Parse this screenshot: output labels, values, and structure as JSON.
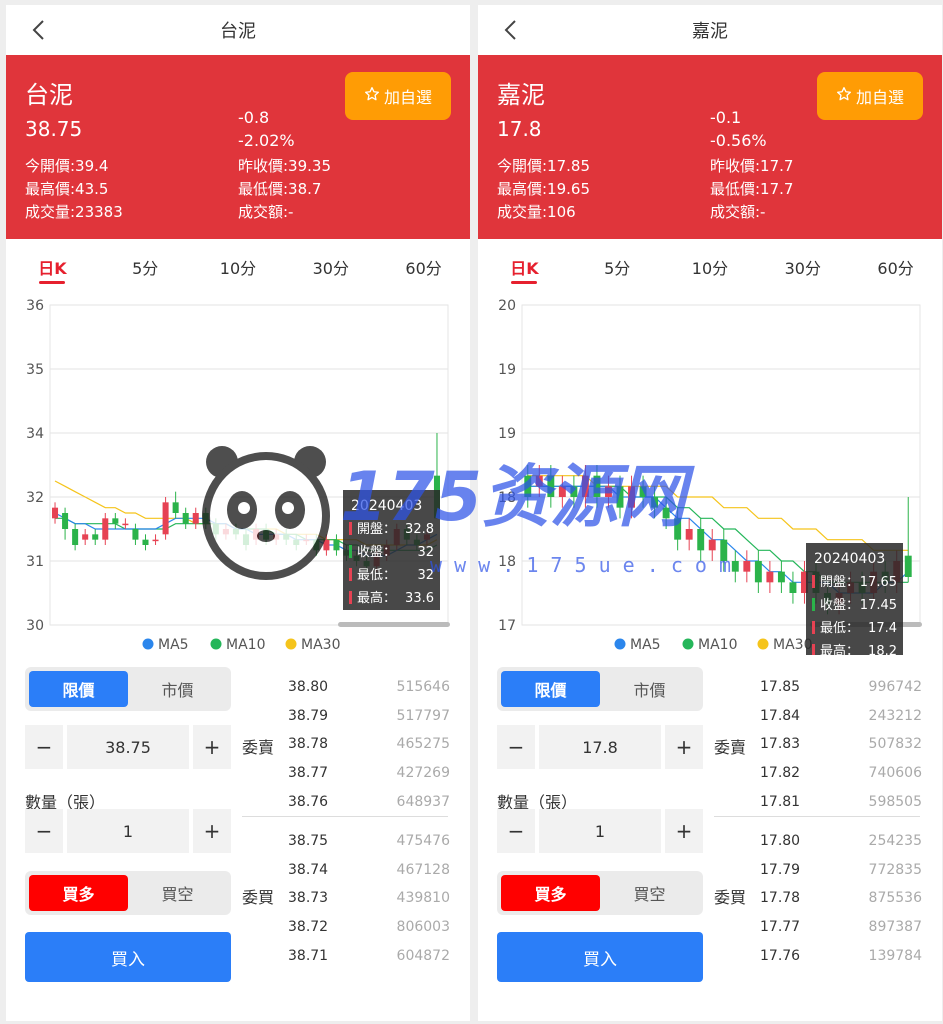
{
  "panels": [
    {
      "nav_title": "台泥",
      "header": {
        "name": "台泥",
        "price": "38.75",
        "change": "-0.8",
        "change_pct": "-2.02%",
        "open": "今開價:39.4",
        "prev_close": "昨收價:39.35",
        "high": "最高價:43.5",
        "low": "最低價:38.7",
        "volume": "成交量:23383",
        "amount": "成交額:-"
      },
      "fav_label": "加自選",
      "tabs": [
        "日K",
        "5分",
        "10分",
        "30分",
        "60分"
      ],
      "chart_data": {
        "type": "candlestick",
        "y_ticks": [
          "36",
          "35",
          "34",
          "32",
          "31",
          "30"
        ],
        "y_range": [
          30,
          36
        ],
        "legend": [
          "MA5",
          "MA10",
          "MA30"
        ],
        "tooltip": {
          "date": "20240403",
          "open_label": "開盤：",
          "open": "32.8",
          "close_label": "收盤：",
          "close": "32",
          "low_label": "最低：",
          "low": "32",
          "high_label": "最高：",
          "high": "33.6"
        },
        "candles": [
          {
            "o": 32.0,
            "c": 32.2,
            "h": 32.3,
            "l": 31.9
          },
          {
            "o": 32.1,
            "c": 31.8,
            "h": 32.2,
            "l": 31.6
          },
          {
            "o": 31.8,
            "c": 31.5,
            "h": 31.9,
            "l": 31.4
          },
          {
            "o": 31.6,
            "c": 31.7,
            "h": 31.8,
            "l": 31.5
          },
          {
            "o": 31.7,
            "c": 31.6,
            "h": 31.8,
            "l": 31.5
          },
          {
            "o": 31.6,
            "c": 32.0,
            "h": 32.1,
            "l": 31.5
          },
          {
            "o": 32.0,
            "c": 31.9,
            "h": 32.1,
            "l": 31.8
          },
          {
            "o": 31.9,
            "c": 31.9,
            "h": 32.0,
            "l": 31.8
          },
          {
            "o": 31.8,
            "c": 31.6,
            "h": 31.9,
            "l": 31.5
          },
          {
            "o": 31.6,
            "c": 31.5,
            "h": 31.7,
            "l": 31.4
          },
          {
            "o": 31.6,
            "c": 31.6,
            "h": 31.7,
            "l": 31.5
          },
          {
            "o": 31.7,
            "c": 32.3,
            "h": 32.4,
            "l": 31.6
          },
          {
            "o": 32.3,
            "c": 32.1,
            "h": 32.5,
            "l": 32.0
          },
          {
            "o": 32.1,
            "c": 31.9,
            "h": 32.2,
            "l": 31.8
          },
          {
            "o": 31.9,
            "c": 32.1,
            "h": 32.2,
            "l": 31.8
          },
          {
            "o": 32.1,
            "c": 31.9,
            "h": 32.2,
            "l": 31.8
          },
          {
            "o": 31.9,
            "c": 31.7,
            "h": 32.0,
            "l": 31.6
          },
          {
            "o": 31.7,
            "c": 31.8,
            "h": 31.9,
            "l": 31.6
          },
          {
            "o": 31.8,
            "c": 31.7,
            "h": 31.9,
            "l": 31.6
          },
          {
            "o": 31.7,
            "c": 31.5,
            "h": 31.8,
            "l": 31.4
          },
          {
            "o": 31.6,
            "c": 31.8,
            "h": 31.9,
            "l": 31.5
          },
          {
            "o": 31.8,
            "c": 31.6,
            "h": 31.9,
            "l": 31.5
          },
          {
            "o": 31.6,
            "c": 31.7,
            "h": 31.8,
            "l": 31.5
          },
          {
            "o": 31.7,
            "c": 31.6,
            "h": 31.8,
            "l": 31.5
          },
          {
            "o": 31.6,
            "c": 31.5,
            "h": 31.7,
            "l": 31.4
          },
          {
            "o": 31.6,
            "c": 31.6,
            "h": 31.7,
            "l": 31.5
          },
          {
            "o": 31.6,
            "c": 31.4,
            "h": 31.7,
            "l": 31.3
          },
          {
            "o": 31.4,
            "c": 31.6,
            "h": 31.7,
            "l": 31.3
          },
          {
            "o": 31.6,
            "c": 31.4,
            "h": 31.7,
            "l": 31.3
          },
          {
            "o": 31.4,
            "c": 31.3,
            "h": 31.5,
            "l": 31.2
          },
          {
            "o": 31.3,
            "c": 31.2,
            "h": 31.4,
            "l": 31.1
          },
          {
            "o": 31.2,
            "c": 31.1,
            "h": 31.3,
            "l": 31.0
          },
          {
            "o": 31.1,
            "c": 31.3,
            "h": 31.4,
            "l": 31.0
          },
          {
            "o": 31.3,
            "c": 31.5,
            "h": 31.6,
            "l": 31.2
          },
          {
            "o": 31.5,
            "c": 31.8,
            "h": 31.9,
            "l": 31.4
          },
          {
            "o": 31.8,
            "c": 31.6,
            "h": 31.9,
            "l": 31.5
          },
          {
            "o": 31.6,
            "c": 31.5,
            "h": 31.7,
            "l": 31.4
          },
          {
            "o": 31.6,
            "c": 31.7,
            "h": 31.8,
            "l": 31.5
          },
          {
            "o": 32.8,
            "c": 32.0,
            "h": 33.6,
            "l": 32.0
          }
        ],
        "ma5": [
          32.1,
          32.0,
          31.9,
          31.9,
          31.8,
          31.8,
          31.8,
          31.8,
          31.8,
          31.8,
          31.8,
          31.9,
          32.0,
          32.0,
          32.0,
          32.0,
          31.9,
          31.9,
          31.8,
          31.8,
          31.7,
          31.7,
          31.7,
          31.7,
          31.6,
          31.6,
          31.6,
          31.5,
          31.5,
          31.4,
          31.4,
          31.3,
          31.3,
          31.3,
          31.4,
          31.5,
          31.5,
          31.6,
          31.7
        ],
        "ma10": [
          32.0,
          32.0,
          31.9,
          31.9,
          31.9,
          31.9,
          31.9,
          31.8,
          31.8,
          31.8,
          31.8,
          31.8,
          31.9,
          31.9,
          31.9,
          31.9,
          31.9,
          31.9,
          31.8,
          31.8,
          31.8,
          31.8,
          31.7,
          31.7,
          31.7,
          31.6,
          31.6,
          31.6,
          31.6,
          31.5,
          31.5,
          31.4,
          31.4,
          31.4,
          31.4,
          31.4,
          31.4,
          31.4,
          31.5
        ],
        "ma30": [
          32.7,
          32.6,
          32.5,
          32.4,
          32.3,
          32.2,
          32.2,
          32.1,
          32.1,
          32.0,
          32.0,
          32.0,
          32.0,
          32.0,
          31.9,
          31.9,
          31.9,
          31.9,
          31.8,
          31.8,
          31.8,
          31.8,
          31.8,
          31.7,
          31.7,
          31.7,
          31.7,
          31.6,
          31.6,
          31.6,
          31.6,
          31.5,
          31.5,
          31.5,
          31.5,
          31.5,
          31.5,
          31.5,
          31.6
        ]
      },
      "trade": {
        "order_type": [
          "限價",
          "市價"
        ],
        "price": "38.75",
        "qty_label": "數量（張）",
        "qty": "1",
        "side": [
          "買多",
          "買空"
        ],
        "submit": "買入",
        "minus": "−",
        "plus": "+"
      },
      "orderbook": {
        "ask_label": "委賣",
        "bid_label": "委買",
        "asks": [
          [
            "38.80",
            "515646"
          ],
          [
            "38.79",
            "517797"
          ],
          [
            "38.78",
            "465275"
          ],
          [
            "38.77",
            "427269"
          ],
          [
            "38.76",
            "648937"
          ]
        ],
        "bids": [
          [
            "38.75",
            "475476"
          ],
          [
            "38.74",
            "467128"
          ],
          [
            "38.73",
            "439810"
          ],
          [
            "38.72",
            "806003"
          ],
          [
            "38.71",
            "604872"
          ]
        ]
      }
    },
    {
      "nav_title": "嘉泥",
      "header": {
        "name": "嘉泥",
        "price": "17.8",
        "change": "-0.1",
        "change_pct": "-0.56%",
        "open": "今開價:17.85",
        "prev_close": "昨收價:17.7",
        "high": "最高價:19.65",
        "low": "最低價:17.7",
        "volume": "成交量:106",
        "amount": "成交額:-"
      },
      "fav_label": "加自選",
      "tabs": [
        "日K",
        "5分",
        "10分",
        "30分",
        "60分"
      ],
      "chart_data": {
        "type": "candlestick",
        "y_ticks": [
          "20",
          "19",
          "19",
          "18",
          "18",
          "17"
        ],
        "y_range": [
          17,
          20
        ],
        "legend": [
          "MA5",
          "MA10",
          "MA30"
        ],
        "tooltip": {
          "date": "20240403",
          "open_label": "開盤：",
          "open": "17.65",
          "close_label": "收盤：",
          "close": "17.45",
          "low_label": "最低：",
          "low": "17.4",
          "high_label": "最高：",
          "high": "18.2"
        },
        "candles": [
          {
            "o": 18.4,
            "c": 18.2,
            "h": 18.5,
            "l": 18.1
          },
          {
            "o": 18.3,
            "c": 18.4,
            "h": 18.5,
            "l": 18.2
          },
          {
            "o": 18.4,
            "c": 18.2,
            "h": 18.5,
            "l": 18.1
          },
          {
            "o": 18.2,
            "c": 18.3,
            "h": 18.4,
            "l": 18.1
          },
          {
            "o": 18.3,
            "c": 18.2,
            "h": 18.4,
            "l": 18.1
          },
          {
            "o": 18.2,
            "c": 18.4,
            "h": 18.5,
            "l": 18.1
          },
          {
            "o": 18.4,
            "c": 18.2,
            "h": 18.5,
            "l": 18.1
          },
          {
            "o": 18.2,
            "c": 18.3,
            "h": 18.4,
            "l": 18.1
          },
          {
            "o": 18.3,
            "c": 18.1,
            "h": 18.4,
            "l": 18.0
          },
          {
            "o": 18.1,
            "c": 18.3,
            "h": 18.4,
            "l": 18.0
          },
          {
            "o": 18.3,
            "c": 18.2,
            "h": 18.4,
            "l": 18.1
          },
          {
            "o": 18.2,
            "c": 18.1,
            "h": 18.3,
            "l": 18.0
          },
          {
            "o": 18.1,
            "c": 18.0,
            "h": 18.2,
            "l": 17.9
          },
          {
            "o": 18.0,
            "c": 17.8,
            "h": 18.1,
            "l": 17.7
          },
          {
            "o": 17.8,
            "c": 17.9,
            "h": 18.0,
            "l": 17.7
          },
          {
            "o": 17.9,
            "c": 17.7,
            "h": 18.0,
            "l": 17.6
          },
          {
            "o": 17.7,
            "c": 17.8,
            "h": 17.9,
            "l": 17.6
          },
          {
            "o": 17.8,
            "c": 17.6,
            "h": 17.9,
            "l": 17.5
          },
          {
            "o": 17.6,
            "c": 17.5,
            "h": 17.7,
            "l": 17.4
          },
          {
            "o": 17.5,
            "c": 17.6,
            "h": 17.7,
            "l": 17.4
          },
          {
            "o": 17.6,
            "c": 17.4,
            "h": 17.7,
            "l": 17.3
          },
          {
            "o": 17.4,
            "c": 17.5,
            "h": 17.6,
            "l": 17.3
          },
          {
            "o": 17.5,
            "c": 17.4,
            "h": 17.6,
            "l": 17.3
          },
          {
            "o": 17.4,
            "c": 17.3,
            "h": 17.5,
            "l": 17.2
          },
          {
            "o": 17.3,
            "c": 17.5,
            "h": 17.6,
            "l": 17.2
          },
          {
            "o": 17.5,
            "c": 17.3,
            "h": 17.6,
            "l": 17.2
          },
          {
            "o": 17.3,
            "c": 17.2,
            "h": 17.4,
            "l": 17.1
          },
          {
            "o": 17.2,
            "c": 17.3,
            "h": 17.4,
            "l": 17.1
          },
          {
            "o": 17.3,
            "c": 17.4,
            "h": 17.5,
            "l": 17.2
          },
          {
            "o": 17.4,
            "c": 17.3,
            "h": 17.5,
            "l": 17.2
          },
          {
            "o": 17.3,
            "c": 17.5,
            "h": 17.6,
            "l": 17.2
          },
          {
            "o": 17.5,
            "c": 17.4,
            "h": 17.6,
            "l": 17.3
          },
          {
            "o": 17.4,
            "c": 17.6,
            "h": 17.7,
            "l": 17.3
          },
          {
            "o": 17.65,
            "c": 17.45,
            "h": 18.2,
            "l": 17.4
          }
        ],
        "ma5": [
          18.3,
          18.3,
          18.3,
          18.3,
          18.3,
          18.3,
          18.3,
          18.3,
          18.2,
          18.2,
          18.2,
          18.2,
          18.1,
          18.0,
          18.0,
          17.9,
          17.8,
          17.8,
          17.7,
          17.6,
          17.6,
          17.5,
          17.5,
          17.4,
          17.4,
          17.4,
          17.4,
          17.3,
          17.3,
          17.3,
          17.3,
          17.4,
          17.4,
          17.5
        ],
        "ma10": [
          18.3,
          18.3,
          18.3,
          18.3,
          18.3,
          18.3,
          18.3,
          18.3,
          18.3,
          18.2,
          18.2,
          18.2,
          18.2,
          18.1,
          18.1,
          18.0,
          18.0,
          17.9,
          17.9,
          17.8,
          17.7,
          17.7,
          17.6,
          17.6,
          17.5,
          17.5,
          17.4,
          17.4,
          17.4,
          17.4,
          17.4,
          17.4,
          17.4,
          17.4
        ],
        "ma30": [
          18.4,
          18.4,
          18.4,
          18.4,
          18.4,
          18.4,
          18.3,
          18.3,
          18.3,
          18.3,
          18.3,
          18.3,
          18.3,
          18.2,
          18.2,
          18.2,
          18.2,
          18.1,
          18.1,
          18.1,
          18.0,
          18.0,
          18.0,
          17.9,
          17.9,
          17.9,
          17.8,
          17.8,
          17.8,
          17.8,
          17.7,
          17.7,
          17.7,
          17.7
        ]
      },
      "trade": {
        "order_type": [
          "限價",
          "市價"
        ],
        "price": "17.8",
        "qty_label": "數量（張）",
        "qty": "1",
        "side": [
          "買多",
          "買空"
        ],
        "submit": "買入",
        "minus": "−",
        "plus": "+"
      },
      "orderbook": {
        "ask_label": "委賣",
        "bid_label": "委買",
        "asks": [
          [
            "17.85",
            "996742"
          ],
          [
            "17.84",
            "243212"
          ],
          [
            "17.83",
            "507832"
          ],
          [
            "17.82",
            "740606"
          ],
          [
            "17.81",
            "598505"
          ]
        ],
        "bids": [
          [
            "17.80",
            "254235"
          ],
          [
            "17.79",
            "772835"
          ],
          [
            "17.78",
            "875536"
          ],
          [
            "17.77",
            "897387"
          ],
          [
            "17.76",
            "139784"
          ]
        ]
      }
    }
  ],
  "watermark": {
    "text": "175资源网",
    "url": "w w w . 1 7 5 u e . c o m"
  },
  "colors": {
    "header_bg": "#e0353b",
    "fav_bg": "#ff9c05",
    "up": "#e64253",
    "down": "#2bb34a",
    "ma5": "#2b86ec",
    "ma10": "#25b65a",
    "ma30": "#f5c41b",
    "blue_btn": "#2b7ef8",
    "red_btn": "#ff0000"
  }
}
